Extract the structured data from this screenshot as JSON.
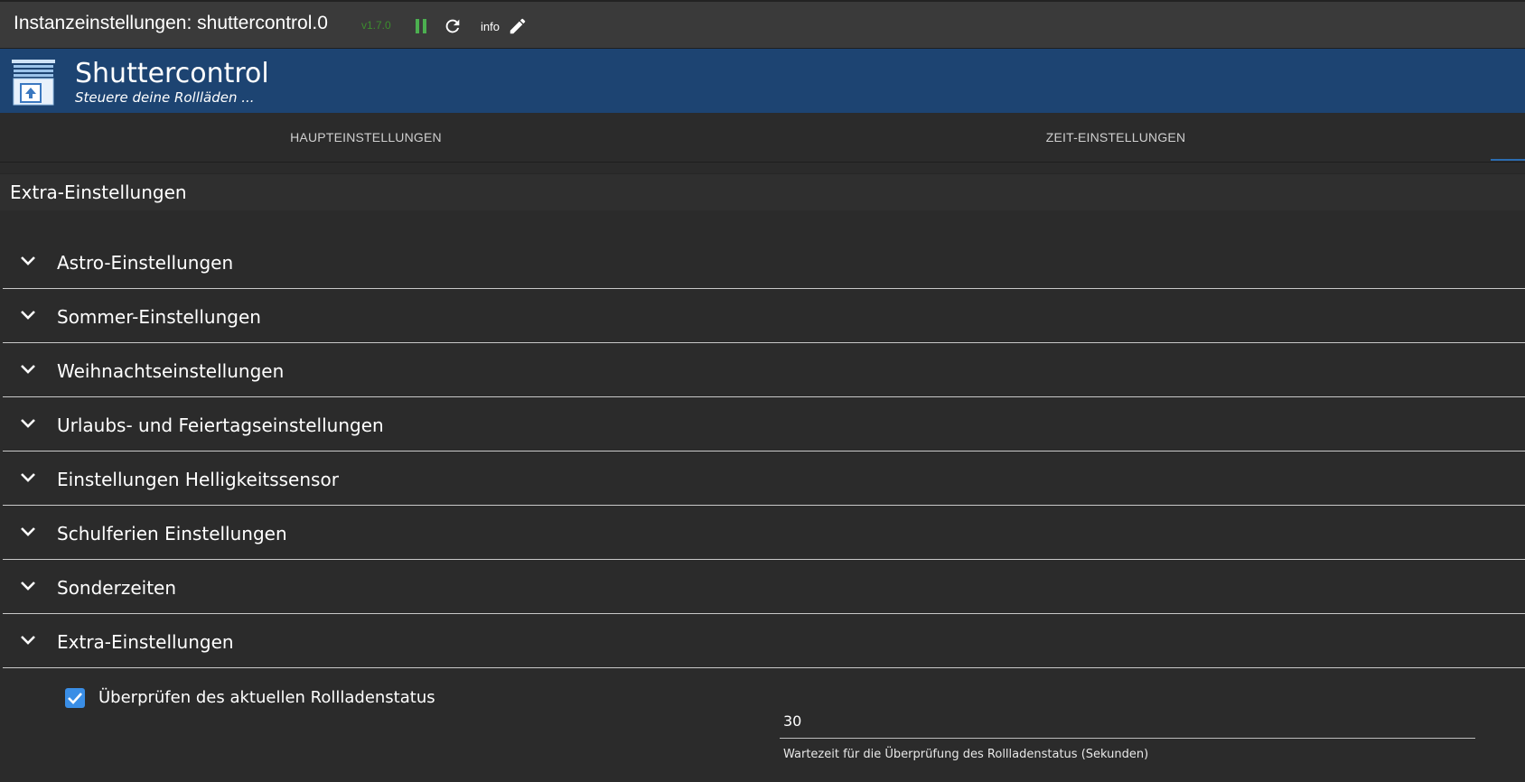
{
  "topbar": {
    "title": "Instanzeinstellungen: shuttercontrol.0",
    "version": "v1.7.0",
    "info_label": "info",
    "icons": [
      "pause-icon",
      "reload-icon",
      "edit-icon"
    ],
    "version_color": "#3c8c2e",
    "pause_color": "#4caf50"
  },
  "header": {
    "app_title": "Shuttercontrol",
    "app_subtitle": "Steuere deine Rollläden ...",
    "background_color": "#1d4472"
  },
  "tabs": [
    {
      "label": "HAUPTEINSTELLUNGEN"
    },
    {
      "label": "ZEIT-EINSTELLUNGEN"
    }
  ],
  "section": {
    "title": "Extra-Einstellungen"
  },
  "panels": [
    {
      "label": "Astro-Einstellungen"
    },
    {
      "label": "Sommer-Einstellungen"
    },
    {
      "label": "Weihnachtseinstellungen"
    },
    {
      "label": "Urlaubs- und Feiertagseinstellungen"
    },
    {
      "label": "Einstellungen Helligkeitssensor"
    },
    {
      "label": "Schulferien Einstellungen"
    },
    {
      "label": "Sonderzeiten"
    },
    {
      "label": "Extra-Einstellungen"
    }
  ],
  "extra": {
    "checkbox_label": "Überprüfen des aktuellen Rollladenstatus",
    "checkbox_checked": true,
    "wait_value": "30",
    "wait_helper": "Wartezeit für die Überprüfung des Rollladenstatus (Sekunden)",
    "accent_color": "#3a8ee6"
  }
}
